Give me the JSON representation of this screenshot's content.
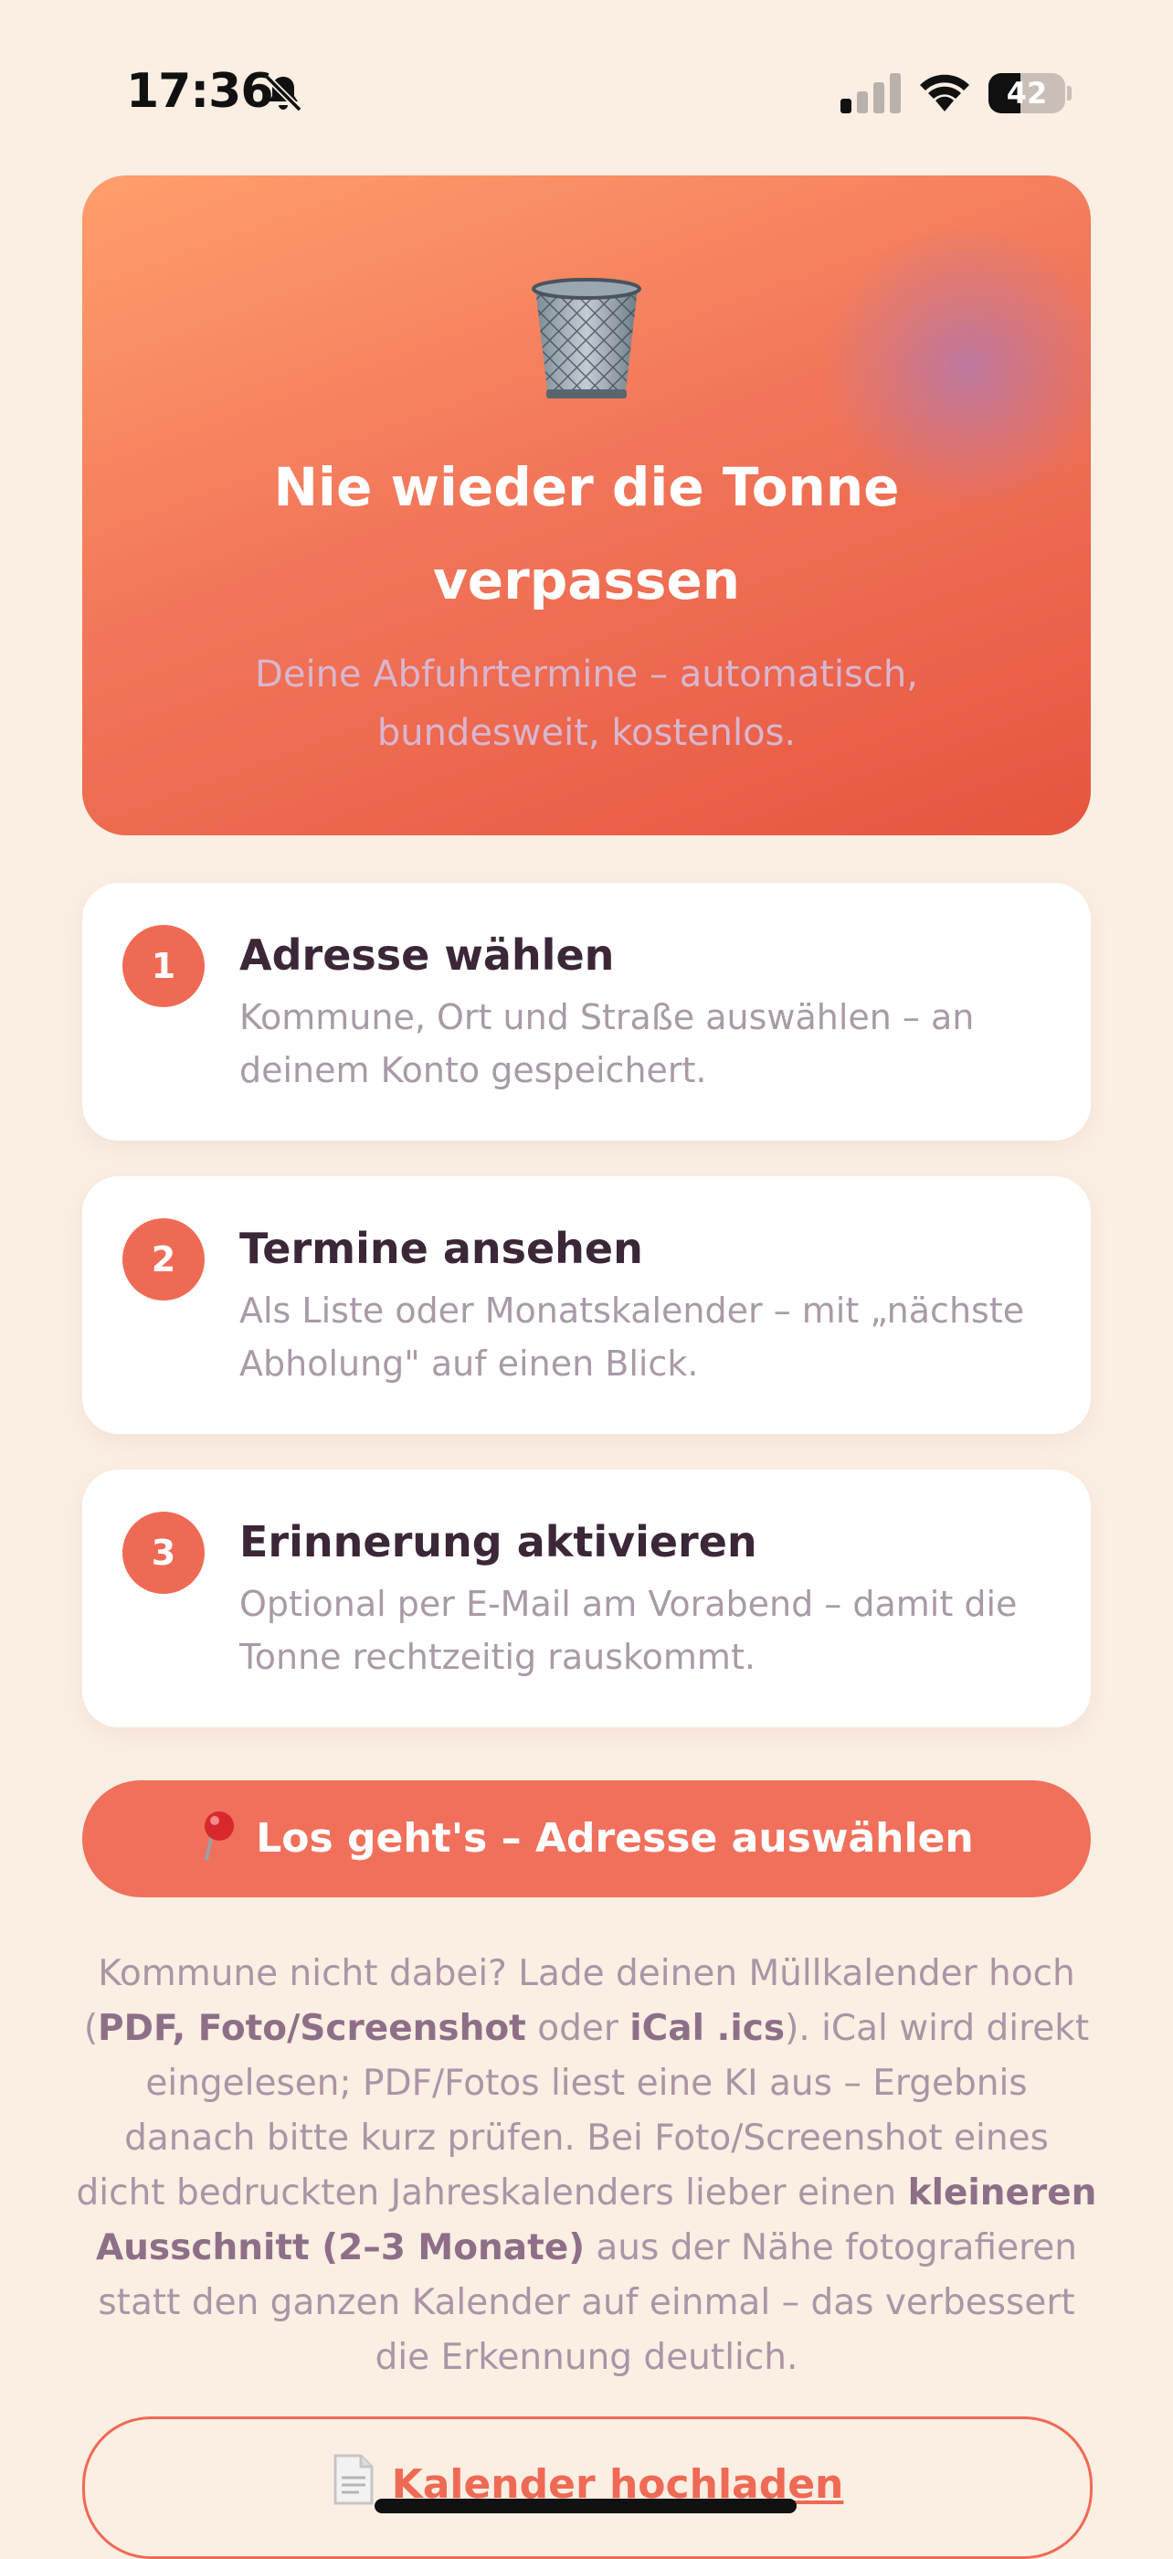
{
  "status_bar": {
    "time": "17:36",
    "battery_percent": "42",
    "battery_level": 0.42,
    "signal_bars_active": 1,
    "signal_bars_total": 4
  },
  "hero": {
    "title": "Nie wieder die Tonne verpassen",
    "subtitle": "Deine Abfuhrtermine – automatisch, bundesweit, kostenlos.",
    "icon": "wastebasket-icon"
  },
  "steps": [
    {
      "number": "1",
      "title": "Adresse wählen",
      "description": "Kommune, Ort und Straße auswählen – an deinem Konto gespeichert."
    },
    {
      "number": "2",
      "title": "Termine ansehen",
      "description": "Als Liste oder Monatskalender – mit „nächste Abholung\" auf einen Blick."
    },
    {
      "number": "3",
      "title": "Erinnerung aktivieren",
      "description": "Optional per E-Mail am Vorabend – damit die Tonne rechtzeitig rauskommt."
    }
  ],
  "cta": {
    "icon": "pin-icon",
    "label": "Los geht's – Adresse auswählen"
  },
  "info": {
    "part1": "Kommune nicht dabei? Lade deinen Müllkalender hoch (",
    "bold1": "PDF, Foto/Screenshot",
    "part2": " oder ",
    "bold2": "iCal .ics",
    "part3": "). iCal wird direkt eingelesen; PDF/Fotos liest eine KI aus – Ergebnis danach bitte kurz prüfen. Bei Foto/Screenshot eines dicht bedruckten Jahreskalenders lieber einen ",
    "bold3": "kleineren Ausschnitt (2–3 Monate)",
    "part4": " aus der Nähe fotografieren statt den ganzen Kalender auf einmal – das verbessert die Erkennung deutlich."
  },
  "upload": {
    "icon": "document-icon",
    "label": "Kalender hochladen"
  },
  "colors": {
    "background": "#fbeee3",
    "accent": "#ef6a55",
    "hero_start": "#ff9e6c",
    "hero_end": "#e6553f"
  }
}
